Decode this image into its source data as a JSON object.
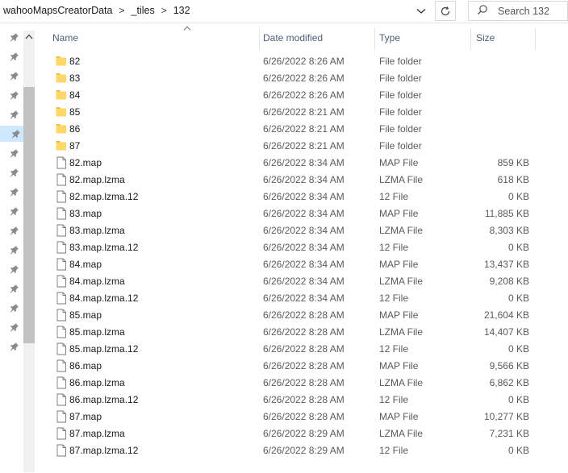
{
  "address": {
    "breadcrumbs": [
      "wahooMapsCreatorData",
      "_tiles",
      "132"
    ],
    "separator": ">"
  },
  "search": {
    "placeholder": "Search 132"
  },
  "columns": {
    "name": "Name",
    "date": "Date modified",
    "type": "Type",
    "size": "Size"
  },
  "files": [
    {
      "name": "82",
      "date": "6/26/2022 8:26 AM",
      "type": "File folder",
      "size": "",
      "kind": "folder"
    },
    {
      "name": "83",
      "date": "6/26/2022 8:26 AM",
      "type": "File folder",
      "size": "",
      "kind": "folder"
    },
    {
      "name": "84",
      "date": "6/26/2022 8:26 AM",
      "type": "File folder",
      "size": "",
      "kind": "folder"
    },
    {
      "name": "85",
      "date": "6/26/2022 8:21 AM",
      "type": "File folder",
      "size": "",
      "kind": "folder"
    },
    {
      "name": "86",
      "date": "6/26/2022 8:21 AM",
      "type": "File folder",
      "size": "",
      "kind": "folder"
    },
    {
      "name": "87",
      "date": "6/26/2022 8:21 AM",
      "type": "File folder",
      "size": "",
      "kind": "folder"
    },
    {
      "name": "82.map",
      "date": "6/26/2022 8:34 AM",
      "type": "MAP File",
      "size": "859 KB",
      "kind": "file"
    },
    {
      "name": "82.map.lzma",
      "date": "6/26/2022 8:34 AM",
      "type": "LZMA File",
      "size": "618 KB",
      "kind": "file"
    },
    {
      "name": "82.map.lzma.12",
      "date": "6/26/2022 8:34 AM",
      "type": "12 File",
      "size": "0 KB",
      "kind": "file"
    },
    {
      "name": "83.map",
      "date": "6/26/2022 8:34 AM",
      "type": "MAP File",
      "size": "11,885 KB",
      "kind": "file"
    },
    {
      "name": "83.map.lzma",
      "date": "6/26/2022 8:34 AM",
      "type": "LZMA File",
      "size": "8,303 KB",
      "kind": "file"
    },
    {
      "name": "83.map.lzma.12",
      "date": "6/26/2022 8:34 AM",
      "type": "12 File",
      "size": "0 KB",
      "kind": "file"
    },
    {
      "name": "84.map",
      "date": "6/26/2022 8:34 AM",
      "type": "MAP File",
      "size": "13,437 KB",
      "kind": "file"
    },
    {
      "name": "84.map.lzma",
      "date": "6/26/2022 8:34 AM",
      "type": "LZMA File",
      "size": "9,208 KB",
      "kind": "file"
    },
    {
      "name": "84.map.lzma.12",
      "date": "6/26/2022 8:34 AM",
      "type": "12 File",
      "size": "0 KB",
      "kind": "file"
    },
    {
      "name": "85.map",
      "date": "6/26/2022 8:28 AM",
      "type": "MAP File",
      "size": "21,604 KB",
      "kind": "file"
    },
    {
      "name": "85.map.lzma",
      "date": "6/26/2022 8:28 AM",
      "type": "LZMA File",
      "size": "14,407 KB",
      "kind": "file"
    },
    {
      "name": "85.map.lzma.12",
      "date": "6/26/2022 8:28 AM",
      "type": "12 File",
      "size": "0 KB",
      "kind": "file"
    },
    {
      "name": "86.map",
      "date": "6/26/2022 8:28 AM",
      "type": "MAP File",
      "size": "9,566 KB",
      "kind": "file"
    },
    {
      "name": "86.map.lzma",
      "date": "6/26/2022 8:28 AM",
      "type": "LZMA File",
      "size": "6,862 KB",
      "kind": "file"
    },
    {
      "name": "86.map.lzma.12",
      "date": "6/26/2022 8:28 AM",
      "type": "12 File",
      "size": "0 KB",
      "kind": "file"
    },
    {
      "name": "87.map",
      "date": "6/26/2022 8:28 AM",
      "type": "MAP File",
      "size": "10,277 KB",
      "kind": "file"
    },
    {
      "name": "87.map.lzma",
      "date": "6/26/2022 8:29 AM",
      "type": "LZMA File",
      "size": "7,231 KB",
      "kind": "file"
    },
    {
      "name": "87.map.lzma.12",
      "date": "6/26/2022 8:29 AM",
      "type": "12 File",
      "size": "0 KB",
      "kind": "file"
    }
  ],
  "nav": {
    "pin_count": 17,
    "selected_pin": 5
  },
  "colors": {
    "folder": "#ffd766",
    "folder_dark": "#e8b93a",
    "header_text": "#4c607a",
    "selection": "#cde8ff"
  },
  "icons": {
    "folder": "folder-icon",
    "file": "file-icon",
    "pin": "pin-icon",
    "refresh": "refresh-icon",
    "search": "search-icon",
    "dropdown": "chevron-down-icon",
    "sort": "sort-caret-icon"
  }
}
